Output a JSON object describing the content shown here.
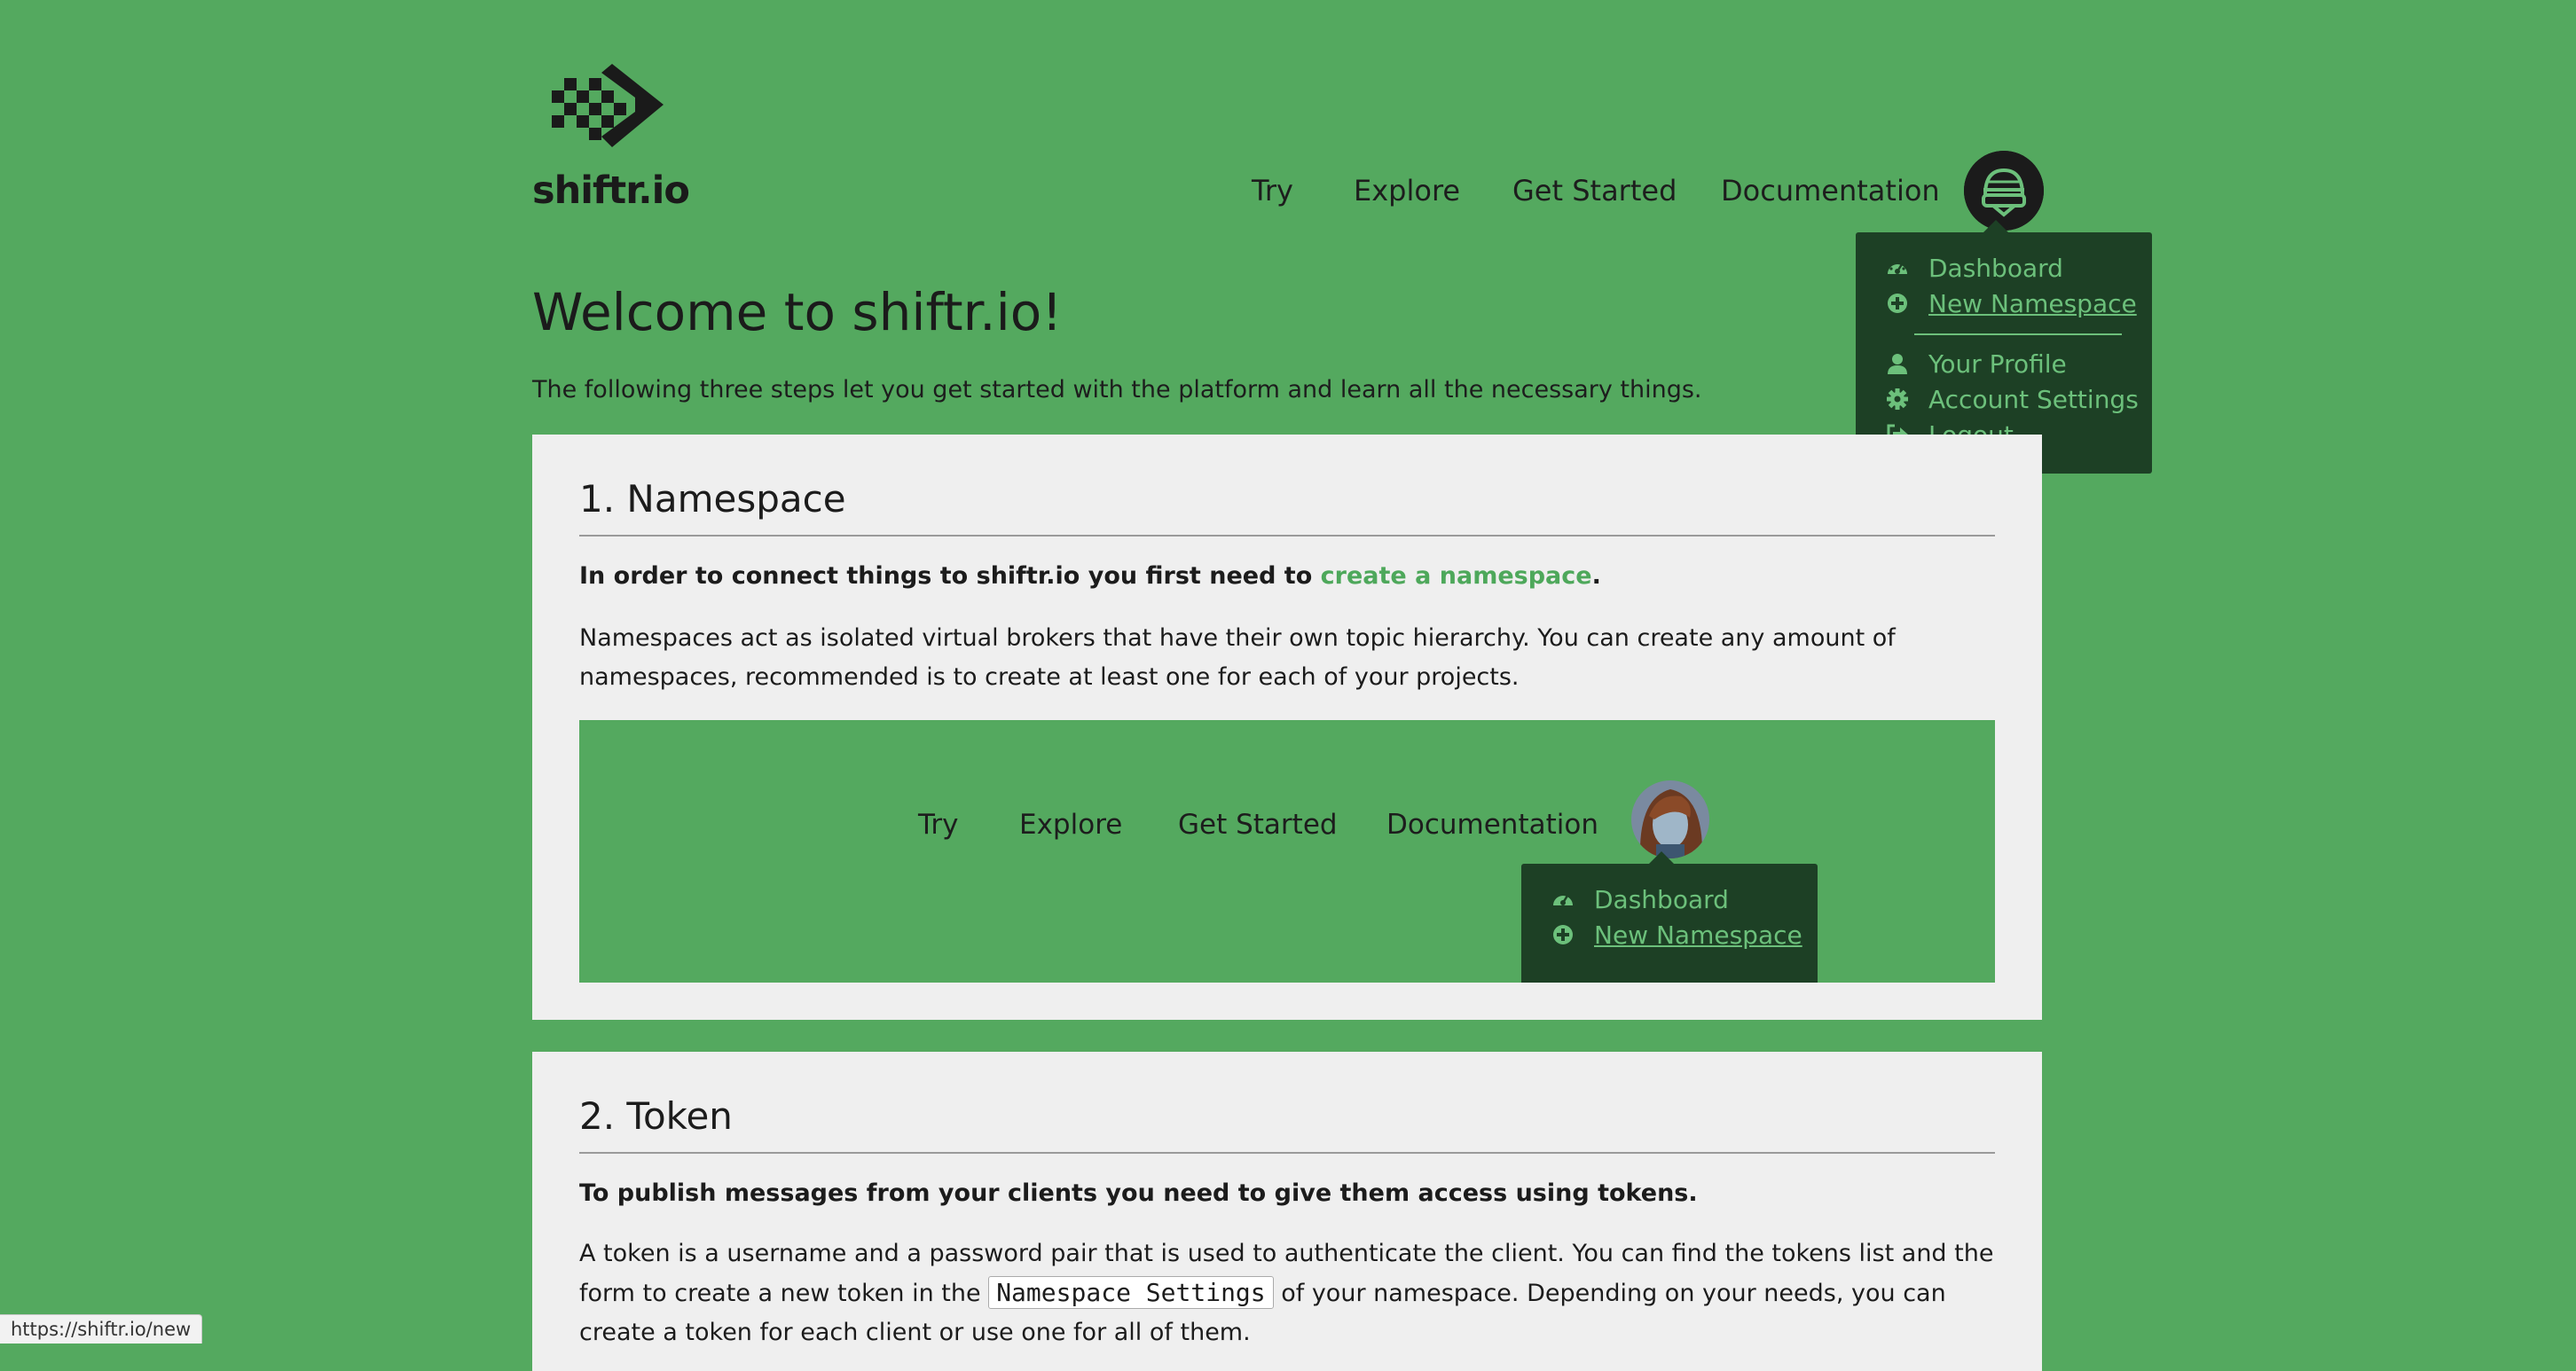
{
  "brand": {
    "name": "shiftr.io"
  },
  "nav": {
    "items": [
      {
        "label": "Try"
      },
      {
        "label": "Explore"
      },
      {
        "label": "Get Started"
      },
      {
        "label": "Documentation"
      }
    ]
  },
  "user_menu": {
    "items": [
      {
        "label": "Dashboard",
        "icon": "dashboard-icon"
      },
      {
        "label": "New Namespace",
        "icon": "plus-circle-icon",
        "underlined": true
      },
      {
        "label": "Your Profile",
        "icon": "user-icon"
      },
      {
        "label": "Account Settings",
        "icon": "gear-icon"
      },
      {
        "label": "Logout",
        "icon": "logout-icon"
      }
    ]
  },
  "page": {
    "title": "Welcome to shiftr.io!",
    "intro": "The following three steps let you get started with the platform and learn all the necessary things."
  },
  "step1": {
    "heading": "1. Namespace",
    "lead_prefix": "In order to connect things to shiftr.io you first need to ",
    "lead_link": "create a namespace",
    "lead_suffix": ".",
    "body": "Namespaces act as isolated virtual brokers that have their own topic hierarchy. You can create any amount of namespaces, recommended is to create at least one for each of your projects.",
    "demo": {
      "nav": [
        "Try",
        "Explore",
        "Get Started",
        "Documentation"
      ],
      "menu": [
        {
          "label": "Dashboard",
          "icon": "dashboard-icon"
        },
        {
          "label": "New Namespace",
          "icon": "plus-circle-icon",
          "underlined": true
        }
      ]
    }
  },
  "step2": {
    "heading": "2. Token",
    "lead": "To publish messages from your clients you need to give them access using tokens.",
    "body_part1": "A token is a username and a password pair that is used to authenticate the client. You can find the tokens list and the form to create a new token in the ",
    "code": "Namespace Settings",
    "body_part2": " of your namespace. Depending on your needs, you can create a token for each client or use one for all of them."
  },
  "status_bar": {
    "url": "https://shiftr.io/new"
  },
  "colors": {
    "background": "#54a95f",
    "menu_bg": "#1d4025",
    "menu_text": "#6cc07b",
    "card_bg": "#efefef",
    "link": "#4ea85b"
  }
}
